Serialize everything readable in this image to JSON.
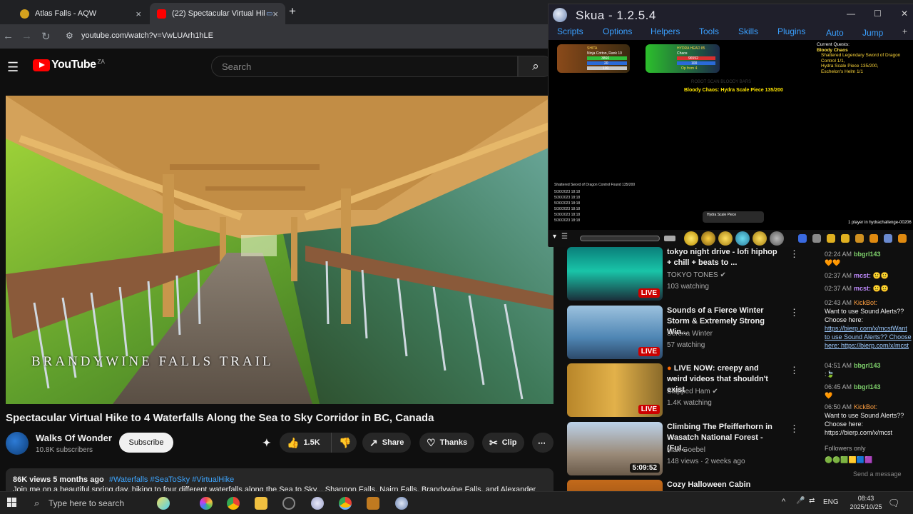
{
  "browser": {
    "tabs": [
      {
        "title": "Atlas Falls - AQW",
        "active": false
      },
      {
        "title": "(22) Spectacular Virtual Hik",
        "active": true
      }
    ],
    "new_tab": "+",
    "close": "×",
    "url": "youtube.com/watch?v=VwLUArh1hLE"
  },
  "youtube": {
    "logo": "YouTube",
    "country": "ZA",
    "search_placeholder": "Search",
    "video_overlay_text": "BRANDYWINE FALLS TRAIL",
    "video_title": "Spectacular Virtual Hike to 4 Waterfalls Along the Sea to Sky Corridor in BC, Canada",
    "channel": {
      "name": "Walks Of Wonder",
      "subscribers": "10.8K subscribers"
    },
    "subscribe_label": "Subscribe",
    "actions": {
      "likes": "1.5K",
      "share": "Share",
      "thanks": "Thanks",
      "clip": "Clip",
      "more": "⋯"
    },
    "description": {
      "stats": "86K views  5 months ago",
      "tags": "#Waterfalls #SeaToSky #VirtualHike",
      "line2": "Join me on a beautiful spring day, hiking to four different waterfalls along the Sea to Sky... Shannon Falls, Nairn Falls, Brandywine Falls, and Alexander"
    },
    "recommendations": [
      {
        "title": "tokyo night drive - lofi hiphop + chill + beats to ...",
        "channel": "TOKYO TONES",
        "verified": true,
        "meta": "103 watching",
        "badge": "LIVE",
        "badge_type": "live"
      },
      {
        "title": "Sounds of a Fierce Winter Storm & Extremely Strong Win...",
        "channel": "Serena Winter",
        "verified": false,
        "meta": "57 watching",
        "badge": "LIVE",
        "badge_type": "live"
      },
      {
        "title": "LIVE NOW: creepy and weird videos that shouldn't exist",
        "channel": "Slapped Ham",
        "verified": true,
        "meta": "1.4K watching",
        "badge": "LIVE",
        "badge_type": "live"
      },
      {
        "title": "Climbing The Pfeifferhorn in Wasatch National Forest - (Ful...",
        "channel": "Max Goebel",
        "verified": false,
        "meta": "148 views · 2 weeks ago",
        "badge": "5:09:52",
        "badge_type": "dur"
      },
      {
        "title": "Cozy Halloween Cabin",
        "channel": "",
        "verified": false,
        "meta": "",
        "badge": "",
        "badge_type": ""
      }
    ],
    "chat": [
      {
        "time": "02:24 AM",
        "user": "bbgrl143",
        "text": "🧡🧡"
      },
      {
        "time": "02:37 AM",
        "user": "mcst:",
        "text": "🙂🙂"
      },
      {
        "time": "02:37 AM",
        "user": "mcst:",
        "text": "🙂🙂"
      },
      {
        "time": "02:43 AM",
        "user": "KickBot:",
        "text": "Want to use Sound Alerts?? Choose here:"
      },
      {
        "time": "",
        "user": "",
        "text": "https://bierp.com/x/mcstWant to use Sound Alerts?? Choose here: https://bierp.com/x/mcst"
      },
      {
        "time": "04:51 AM",
        "user": "bbgrl143",
        "text": ":🍃"
      },
      {
        "time": "06:45 AM",
        "user": "bbgrl143",
        "text": "🧡"
      },
      {
        "time": "06:50 AM",
        "user": "KickBot:",
        "text": "Want to use Sound Alerts?? Choose here: https://bierp.com/x/mcst"
      }
    ],
    "chat_followers_only": "Followers only",
    "chat_send_placeholder": "Send a message"
  },
  "skua": {
    "title": "Skua - 1.2.5.4",
    "menu": [
      "Scripts",
      "Options",
      "Helpers",
      "Tools",
      "Skills",
      "Plugins",
      "Auto",
      "Jump"
    ],
    "add": "+",
    "player_card": {
      "name": "SHITA",
      "class": "Ninja Cotton, Rank 10",
      "hp": "3860",
      "mp": "20",
      "sp": "100"
    },
    "target_card": {
      "name": "HYDRA HEAD 85",
      "level": "Chaos",
      "hp": "96552",
      "mp": "100",
      "sp": "Op from 4"
    },
    "quests": {
      "heading": "Current Quests:",
      "quest": "Bloody Chaos",
      "lines": [
        "Shattered Legendary Sword of Dragon Control 1/1,",
        "Hydra Scale Piece 135/200,",
        "Eschelon's Helm 1/1"
      ]
    },
    "chase_message": "Bloody Chaos: Hydra Scale Piece 135/200",
    "chase_shadow": "ROBOT SCAN BLOODY BARS",
    "log_lines": [
      "Shattered Sword of Dragon Control Found 135/200",
      "5/30/2023 18:18",
      "5/30/2023 18:18",
      "5/30/2023 18:18",
      "5/30/2023 18:18",
      "5/30/2023 18:18",
      "5/30/2023 18:18"
    ],
    "item_tooltip": "Hydra Scale Piece",
    "players_online": "1 player in hydrachallenge-00206"
  },
  "taskbar": {
    "search_placeholder": "Type here to search",
    "language": "ENG",
    "time": "08:43",
    "date": "2025/10/25"
  }
}
